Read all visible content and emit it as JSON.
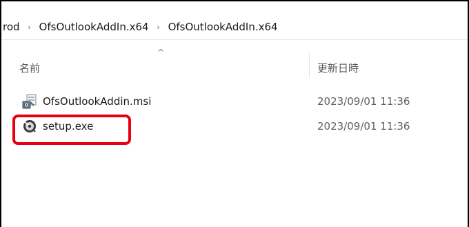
{
  "breadcrumb": {
    "items": [
      "rod",
      "OfsOutlookAddIn.x64",
      "OfsOutlookAddIn.x64"
    ],
    "separator": "›"
  },
  "columns": {
    "name": "名前",
    "date_modified": "更新日時",
    "sort_indicator": "^"
  },
  "files": [
    {
      "name": "OfsOutlookAddin.msi",
      "date": "2023/09/01 11:36",
      "icon": "msi-installer-icon"
    },
    {
      "name": "setup.exe",
      "date": "2023/09/01 11:36",
      "icon": "setup-exe-icon"
    }
  ],
  "highlight_color": "#e60012"
}
